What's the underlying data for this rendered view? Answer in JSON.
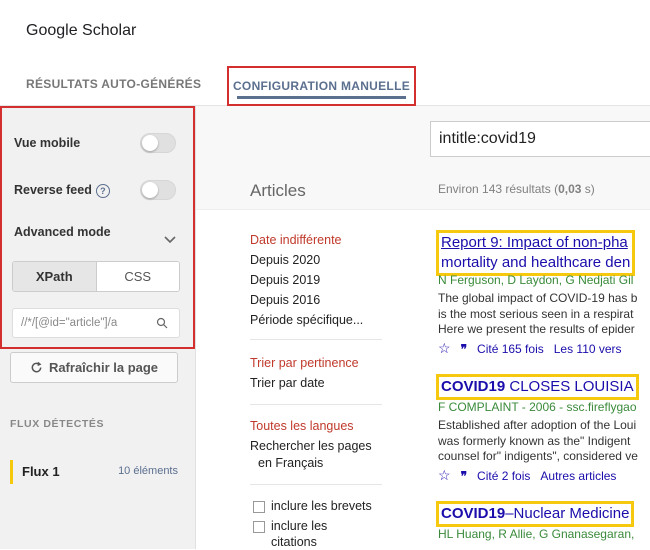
{
  "app": {
    "title": "Google Scholar"
  },
  "tabs": [
    {
      "label": "RÉSULTATS AUTO-GÉNÉRÉS"
    },
    {
      "label": "CONFIGURATION MANUELLE"
    }
  ],
  "sidebar": {
    "vue_mobile": "Vue mobile",
    "reverse_feed": "Reverse feed",
    "help": "?",
    "advanced_mode": "Advanced mode",
    "seg_xpath": "XPath",
    "seg_css": "CSS",
    "xpath_value": "//*/[@id=\"article\"]/a",
    "refresh": "Rafraîchir la page",
    "flux_heading": "FLUX DÉTECTÉS",
    "flux_name": "Flux 1",
    "flux_count": "10 éléments"
  },
  "search": {
    "query": "intitle:covid19",
    "articles": "Articles",
    "results_prefix": "Environ 143 résultats (",
    "results_time": "0,03",
    "results_suffix": " s)"
  },
  "filters": {
    "date_any": "Date indifférente",
    "since_2020": "Depuis 2020",
    "since_2019": "Depuis 2019",
    "since_2016": "Depuis 2016",
    "custom_period": "Période spécifique...",
    "sort_relevance": "Trier par pertinence",
    "sort_date": "Trier par date",
    "all_langs": "Toutes les langues",
    "search_pages": "Rechercher les pages",
    "in_french": "en Français",
    "include_patents": "inclure les brevets",
    "include_citations_1": "inclure les",
    "include_citations_2": "citations"
  },
  "results": [
    {
      "title_line1": "Report 9: Impact of non-pha",
      "title_line2": "mortality and healthcare den",
      "meta": "N Ferguson, D Laydon, G Nedjati Gil",
      "snippet1": "The global impact of COVID-19 has b",
      "snippet2": "is the most serious seen in a respirat",
      "snippet3": "Here we present the results of epider",
      "cited": "Cité 165 fois",
      "versions": "Les 110 vers"
    },
    {
      "title_bold": "COVID19",
      "title_rest": " CLOSES LOUISIA",
      "meta": "F COMPLAINT - 2006 - ssc.fireflygao",
      "snippet1": "Established after adoption of the Loui",
      "snippet2": "was formerly known as the\" Indigent",
      "snippet3": "counsel for\" indigents\", considered ve",
      "cited": "Cité 2 fois",
      "versions": "Autres articles"
    },
    {
      "title_bold": "COVID19",
      "title_rest": "–Nuclear Medicine",
      "meta": "HL Huang, R Allie, G Gnanasegaran,"
    }
  ],
  "colors": {
    "highlight_red": "#d32f2f",
    "highlight_yellow": "#f6c90e",
    "link_blue": "#1a0dab",
    "accent": "#5b6f8f"
  }
}
